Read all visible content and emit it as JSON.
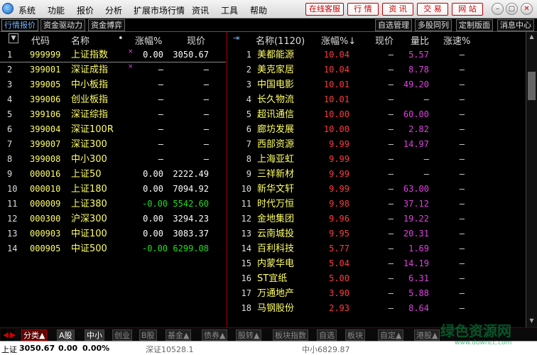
{
  "menu": [
    "系统",
    "功能",
    "报价",
    "分析",
    "扩展市场行情",
    "资讯",
    "工具",
    "帮助"
  ],
  "top_buttons": [
    "在线客服",
    "行 情",
    "资 讯",
    "交 易",
    "网 站"
  ],
  "window_buttons": [
    "minimize-icon",
    "restore-icon",
    "close-icon"
  ],
  "toolbar_left_tabs": [
    "行情报价",
    "资金驱动力",
    "资金博弈"
  ],
  "toolbar_right_tabs": [
    "自选管理",
    "多股同列",
    "定制版面",
    "消息中心"
  ],
  "left_table": {
    "headers": [
      "代码",
      "名称",
      "•",
      "涨幅%",
      "现价"
    ],
    "rows": [
      {
        "idx": "1",
        "code": "999999",
        "name": "上证指数",
        "mark": "×",
        "chg": "0.00",
        "price": "3050.67",
        "pc": "#ffffff"
      },
      {
        "idx": "2",
        "code": "399001",
        "name": "深证成指",
        "mark": "×",
        "chg": "–",
        "price": "–",
        "pc": "#ffffff"
      },
      {
        "idx": "3",
        "code": "399005",
        "name": "中小板指",
        "mark": "",
        "chg": "–",
        "price": "–",
        "pc": "#ffffff"
      },
      {
        "idx": "4",
        "code": "399006",
        "name": "创业板指",
        "mark": "",
        "chg": "–",
        "price": "–",
        "pc": "#ffffff"
      },
      {
        "idx": "5",
        "code": "399106",
        "name": "深证综指",
        "mark": "",
        "chg": "–",
        "price": "–",
        "pc": "#ffffff"
      },
      {
        "idx": "6",
        "code": "399004",
        "name": "深证100R",
        "mark": "",
        "chg": "–",
        "price": "–",
        "pc": "#ffffff"
      },
      {
        "idx": "7",
        "code": "399007",
        "name": "深证300",
        "mark": "",
        "chg": "–",
        "price": "–",
        "pc": "#ffffff"
      },
      {
        "idx": "8",
        "code": "399008",
        "name": "中小300",
        "mark": "",
        "chg": "–",
        "price": "–",
        "pc": "#ffffff"
      },
      {
        "idx": "9",
        "code": "000016",
        "name": "上证50",
        "mark": "",
        "chg": "0.00",
        "price": "2222.49",
        "pc": "#ffffff"
      },
      {
        "idx": "10",
        "code": "000010",
        "name": "上证180",
        "mark": "",
        "chg": "0.00",
        "price": "7094.92",
        "pc": "#ffffff"
      },
      {
        "idx": "11",
        "code": "000009",
        "name": "上证380",
        "mark": "",
        "chg": "-0.00",
        "price": "5542.60",
        "pc": "#22dd22"
      },
      {
        "idx": "12",
        "code": "000300",
        "name": "沪深300",
        "mark": "",
        "chg": "0.00",
        "price": "3294.23",
        "pc": "#ffffff"
      },
      {
        "idx": "13",
        "code": "000903",
        "name": "中证100",
        "mark": "",
        "chg": "0.00",
        "price": "3083.37",
        "pc": "#ffffff"
      },
      {
        "idx": "14",
        "code": "000905",
        "name": "中证500",
        "mark": "",
        "chg": "-0.00",
        "price": "6299.08",
        "pc": "#22dd22"
      }
    ]
  },
  "right_table": {
    "headers": [
      "名称(1120)",
      "涨幅%↓",
      "现价",
      "量比",
      "涨速%"
    ],
    "rows": [
      {
        "idx": "1",
        "name": "美都能源",
        "chg": "10.04",
        "price": "–",
        "ratio": "5.57",
        "speed": "–"
      },
      {
        "idx": "2",
        "name": "美克家居",
        "chg": "10.04",
        "price": "–",
        "ratio": "8.78",
        "speed": "–"
      },
      {
        "idx": "3",
        "name": "中国电影",
        "chg": "10.01",
        "price": "–",
        "ratio": "49.20",
        "speed": "–"
      },
      {
        "idx": "4",
        "name": "长久物流",
        "chg": "10.01",
        "price": "–",
        "ratio": "–",
        "speed": "–"
      },
      {
        "idx": "5",
        "name": "超讯通信",
        "chg": "10.00",
        "price": "–",
        "ratio": "60.00",
        "speed": "–"
      },
      {
        "idx": "6",
        "name": "廊坊发展",
        "chg": "10.00",
        "price": "–",
        "ratio": "2.82",
        "speed": "–"
      },
      {
        "idx": "7",
        "name": "西部资源",
        "chg": "9.99",
        "price": "–",
        "ratio": "14.97",
        "speed": "–"
      },
      {
        "idx": "8",
        "name": "上海亚虹",
        "chg": "9.99",
        "price": "–",
        "ratio": "–",
        "speed": "–"
      },
      {
        "idx": "9",
        "name": "三祥新材",
        "chg": "9.99",
        "price": "–",
        "ratio": "–",
        "speed": "–"
      },
      {
        "idx": "10",
        "name": "新华文轩",
        "chg": "9.99",
        "price": "–",
        "ratio": "63.00",
        "speed": "–"
      },
      {
        "idx": "11",
        "name": "时代万恒",
        "chg": "9.98",
        "price": "–",
        "ratio": "37.12",
        "speed": "–"
      },
      {
        "idx": "12",
        "name": "金地集团",
        "chg": "9.96",
        "price": "–",
        "ratio": "19.22",
        "speed": "–"
      },
      {
        "idx": "13",
        "name": "云南城投",
        "chg": "9.95",
        "price": "–",
        "ratio": "20.31",
        "speed": "–"
      },
      {
        "idx": "14",
        "name": "百利科技",
        "chg": "5.77",
        "price": "–",
        "ratio": "1.69",
        "speed": "–"
      },
      {
        "idx": "15",
        "name": "内蒙华电",
        "chg": "5.04",
        "price": "–",
        "ratio": "14.19",
        "speed": "–"
      },
      {
        "idx": "16",
        "name": "ST宜纸",
        "chg": "5.00",
        "price": "–",
        "ratio": "6.31",
        "speed": "–"
      },
      {
        "idx": "17",
        "name": "万通地产",
        "chg": "3.90",
        "price": "–",
        "ratio": "5.88",
        "speed": "–"
      },
      {
        "idx": "18",
        "name": "马钢股份",
        "chg": "2.93",
        "price": "–",
        "ratio": "8.64",
        "speed": "–"
      }
    ]
  },
  "bottom_tabs": [
    "分类▲",
    "A股",
    "中小",
    "创业",
    "B股",
    "基金▲",
    "债券▲",
    "股转▲",
    "板块指数",
    "自选",
    "板块",
    "自定▲",
    "港股▲"
  ],
  "status": {
    "index1_name": "上证",
    "index1_price": "3050.67",
    "index1_chg": "0.00",
    "index1_pct": "0.00%",
    "index2": "深证10528.1",
    "index3": "中小6829.87"
  },
  "watermark": "绿色资源网",
  "watermark_url": "www.downcc.com",
  "colors": {
    "rise": "#ff3b3b",
    "ratio": "#e040e0",
    "code": "#ffff66",
    "name": "#ffff66",
    "fall": "#22dd22",
    "border_red": "#bb0000"
  }
}
